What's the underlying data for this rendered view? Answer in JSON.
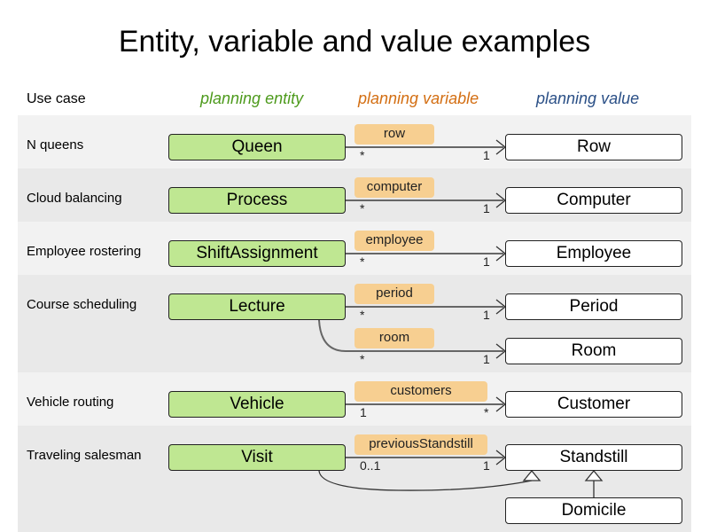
{
  "title": "Entity, variable and value examples",
  "headers": {
    "use_case": "Use case",
    "planning_entity": "planning entity",
    "planning_variable": "planning variable",
    "planning_value": "planning value"
  },
  "colors": {
    "entity_header": "#4d9a1c",
    "variable_header": "#d36e12",
    "value_header": "#2a4f86",
    "entity_fill": "#bfe792",
    "variable_fill": "#f7cf91",
    "band_odd": "#f2f2f2",
    "band_even": "#e9e9e9"
  },
  "rows": [
    {
      "use_case": "N queens",
      "entity": "Queen",
      "variables": [
        {
          "name": "row",
          "from_mult": "*",
          "to_mult": "1",
          "value": "Row"
        }
      ]
    },
    {
      "use_case": "Cloud balancing",
      "entity": "Process",
      "variables": [
        {
          "name": "computer",
          "from_mult": "*",
          "to_mult": "1",
          "value": "Computer"
        }
      ]
    },
    {
      "use_case": "Employee rostering",
      "entity": "ShiftAssignment",
      "variables": [
        {
          "name": "employee",
          "from_mult": "*",
          "to_mult": "1",
          "value": "Employee"
        }
      ]
    },
    {
      "use_case": "Course scheduling",
      "entity": "Lecture",
      "variables": [
        {
          "name": "period",
          "from_mult": "*",
          "to_mult": "1",
          "value": "Period"
        },
        {
          "name": "room",
          "from_mult": "*",
          "to_mult": "1",
          "value": "Room"
        }
      ]
    },
    {
      "use_case": "Vehicle routing",
      "entity": "Vehicle",
      "variables": [
        {
          "name": "customers",
          "from_mult": "1",
          "to_mult": "*",
          "value": "Customer"
        }
      ]
    },
    {
      "use_case": "Traveling salesman",
      "entity": "Visit",
      "variables": [
        {
          "name": "previousStandstill",
          "from_mult": "0..1",
          "to_mult": "1",
          "value": "Standstill"
        }
      ],
      "subclass": "Domicile"
    }
  ]
}
